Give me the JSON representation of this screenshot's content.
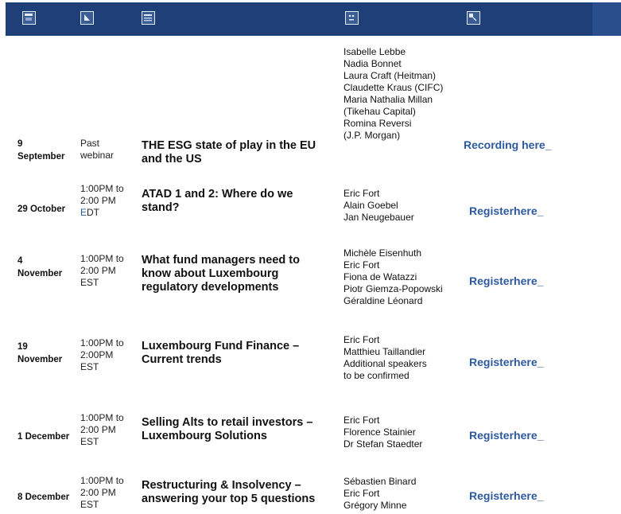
{
  "header": {
    "icons": [
      "calendar-icon",
      "clock-icon",
      "document-icon",
      "speakers-icon",
      "register-icon"
    ],
    "colors": {
      "bar": "#1f3f78",
      "accent": "#2d5a9e"
    }
  },
  "events": [
    {
      "date": [
        "9",
        "September"
      ],
      "time": [
        "Past",
        "webinar"
      ],
      "title": [
        "THE ESG state of play in the EU",
        "and the US"
      ],
      "speakers": [
        "Isabelle Lebbe",
        "Nadia Bonnet",
        "Laura Craft (Heitman)",
        "Claudette Kraus (CIFC)",
        "Maria Nathalia Millan",
        "(Tikehau Capital)",
        "Romina Reversi",
        "(J.P. Morgan)"
      ],
      "action": [
        "Recording here_"
      ]
    },
    {
      "date": [
        "29 October"
      ],
      "time": [
        "1:00PM to",
        "2:00 PM",
        "EDT"
      ],
      "title": [
        "ATAD 1 and 2: Where do we",
        "stand?"
      ],
      "speakers": [
        "Eric Fort",
        "Alain Goebel",
        "Jan Neugebauer"
      ],
      "action": [
        "Register",
        "here_"
      ]
    },
    {
      "date": [
        "4",
        "November"
      ],
      "time": [
        "1:00PM to",
        "2:00 PM",
        "EST"
      ],
      "title": [
        "What fund managers need to",
        "know about Luxembourg",
        "regulatory developments"
      ],
      "speakers": [
        "Michèle Eisenhuth",
        "Eric Fort",
        "Fiona de Watazzi",
        "Piotr Giemza-Popowski",
        "Géraldine Léonard"
      ],
      "action": [
        "Register",
        "here_"
      ]
    },
    {
      "date": [
        "19",
        "November"
      ],
      "time": [
        "1:00PM to",
        "2:00PM",
        "EST"
      ],
      "title": [
        "Luxembourg Fund Finance –",
        "Current trends"
      ],
      "speakers": [
        "Eric Fort",
        "Matthieu Taillandier",
        "Additional speakers",
        "to be confirmed"
      ],
      "action": [
        "Register",
        "here_"
      ]
    },
    {
      "date": [
        "1 December"
      ],
      "time": [
        "1:00PM to",
        "2:00 PM",
        "EST"
      ],
      "title": [
        "Selling Alts to retail investors –",
        "Luxembourg Solutions"
      ],
      "speakers": [
        "Eric Fort",
        "Florence Stainier",
        "Dr Stefan Staedter"
      ],
      "action": [
        "Register",
        "here_"
      ]
    },
    {
      "date": [
        "8 December"
      ],
      "time": [
        "1:00PM to",
        "2:00 PM",
        "EST"
      ],
      "title": [
        "Restructuring & Insolvency –",
        "answering your top 5 questions"
      ],
      "speakers": [
        "Sébastien Binard",
        "Eric Fort",
        "Grégory Minne"
      ],
      "action": [
        "Register",
        "here_"
      ]
    }
  ]
}
